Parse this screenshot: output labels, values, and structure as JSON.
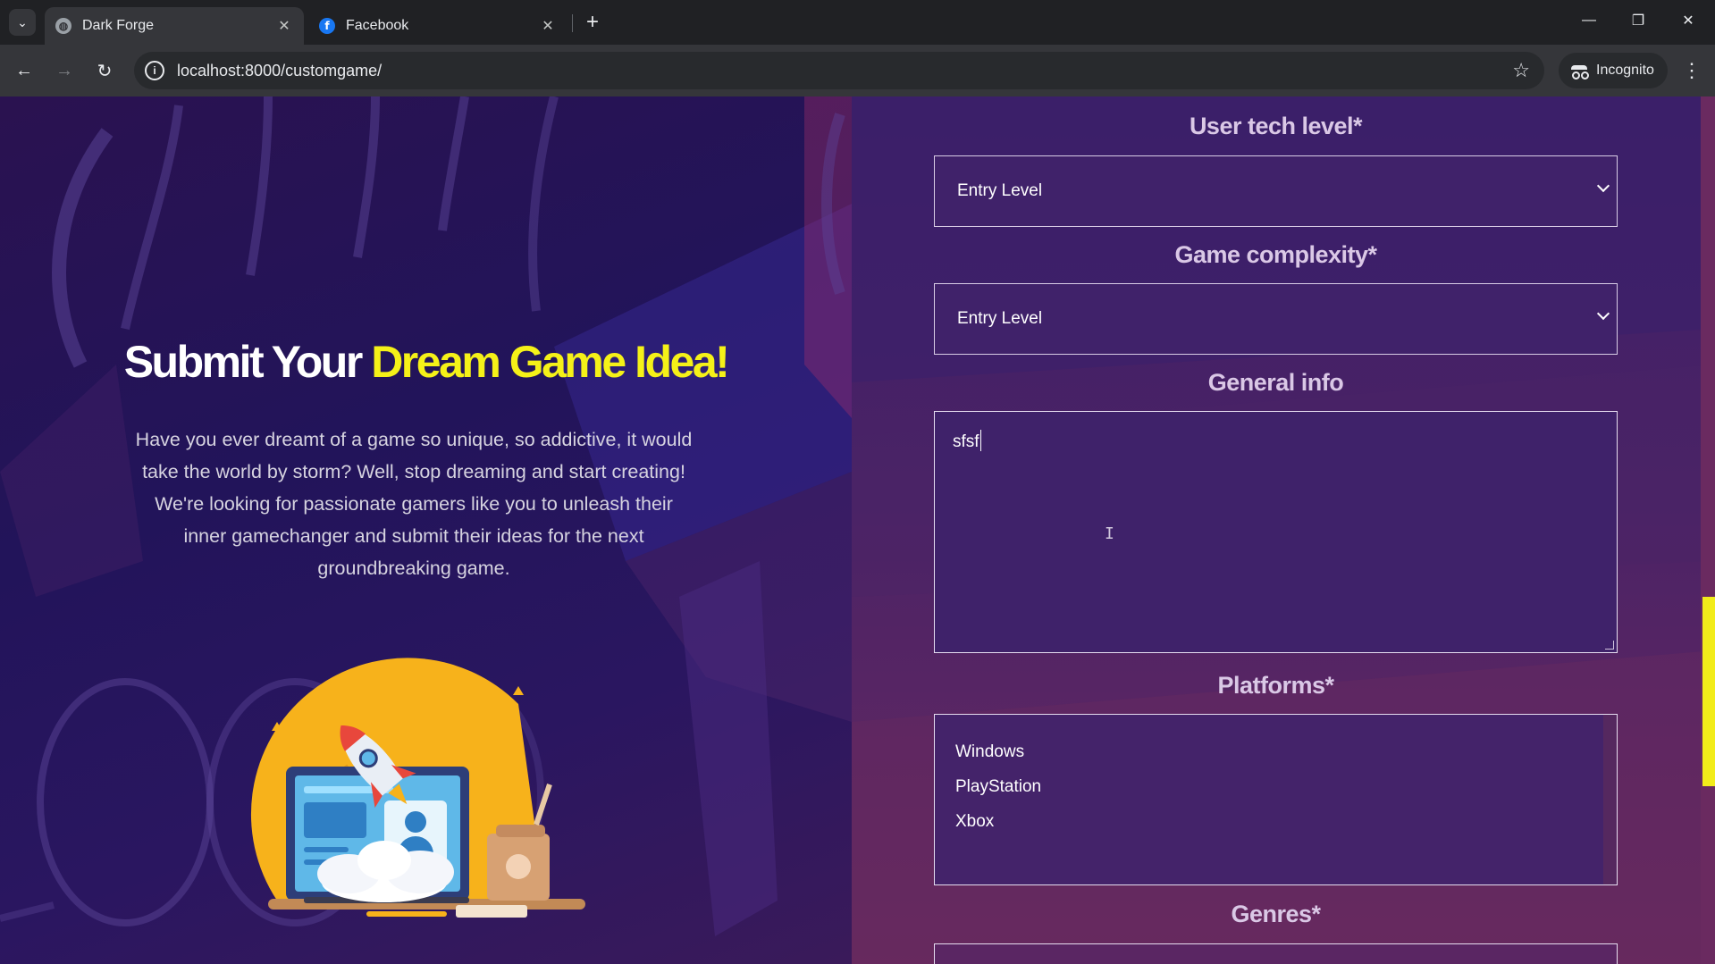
{
  "browser": {
    "tabs": [
      {
        "title": "Dark Forge",
        "active": true,
        "favicon": "globe-icon"
      },
      {
        "title": "Facebook",
        "active": false,
        "favicon": "facebook-icon"
      }
    ],
    "url": "localhost:8000/customgame/",
    "incognito_label": "Incognito"
  },
  "hero": {
    "title_plain": "Submit Your",
    "title_accent": "Dream Game Idea!",
    "description": "Have you ever dreamt of a game so unique, so addictive, it would take the world by storm? Well, stop dreaming and start creating! We're looking for passionate gamers like you to unleash their inner gamechanger and submit their ideas for the next groundbreaking game.",
    "illustration": "rocket-laptop-illustration"
  },
  "form": {
    "tech_level": {
      "label": "User tech level*",
      "value": "Entry Level"
    },
    "complexity": {
      "label": "Game complexity*",
      "value": "Entry Level"
    },
    "general_info": {
      "label": "General info",
      "value": "sfsf"
    },
    "platforms": {
      "label": "Platforms*",
      "options": [
        "Windows",
        "PlayStation",
        "Xbox"
      ]
    },
    "genres": {
      "label": "Genres*"
    }
  },
  "colors": {
    "accent_yellow": "#f5f118",
    "panel_purple": "#40226a",
    "left_bg": "#22145a",
    "right_bg": "#5a2663"
  }
}
